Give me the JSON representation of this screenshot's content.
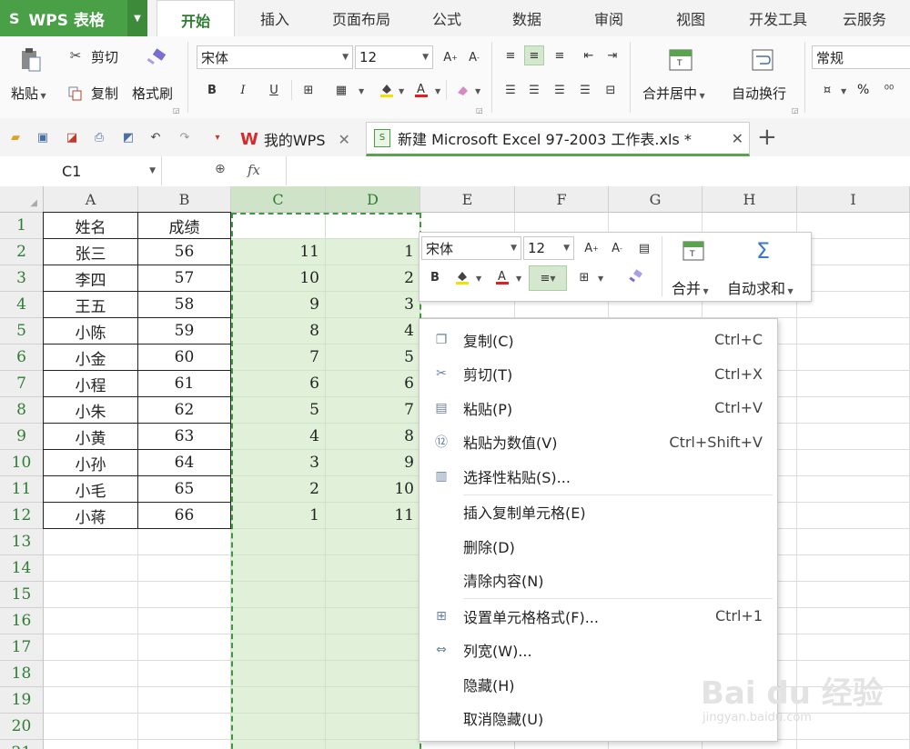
{
  "app": {
    "logo": "S",
    "title": "WPS 表格"
  },
  "menu_tabs": [
    "开始",
    "插入",
    "页面布局",
    "公式",
    "数据",
    "审阅",
    "视图",
    "开发工具",
    "云服务"
  ],
  "ribbon": {
    "paste": "粘贴",
    "cut": "剪切",
    "copy": "复制",
    "format_painter": "格式刷",
    "font_name": "宋体",
    "font_size": "12",
    "merge_center": "合并居中",
    "wrap_text": "自动换行",
    "number_format": "常规",
    "percent": "%"
  },
  "doc_tabs": {
    "home": "我的WPS",
    "file": "新建 Microsoft Excel 97-2003 工作表.xls *",
    "add": "+"
  },
  "formula_bar": {
    "name_box": "C1",
    "fx": "fx"
  },
  "columns": [
    "A",
    "B",
    "C",
    "D",
    "E",
    "F",
    "G",
    "H",
    "I"
  ],
  "rows": [
    "1",
    "2",
    "3",
    "4",
    "5",
    "6",
    "7",
    "8",
    "9",
    "10",
    "11",
    "12",
    "13",
    "14",
    "15",
    "16",
    "17",
    "18",
    "19",
    "20",
    "21"
  ],
  "sheet": {
    "A": [
      "姓名",
      "张三",
      "李四",
      "王五",
      "小陈",
      "小金",
      "小程",
      "小朱",
      "小黄",
      "小孙",
      "小毛",
      "小蒋"
    ],
    "B": [
      "成绩",
      "56",
      "57",
      "58",
      "59",
      "60",
      "61",
      "62",
      "63",
      "64",
      "65",
      "66"
    ],
    "C": [
      "",
      "11",
      "10",
      "9",
      "8",
      "7",
      "6",
      "5",
      "4",
      "3",
      "2",
      "1"
    ],
    "D": [
      "",
      "1",
      "2",
      "3",
      "4",
      "5",
      "6",
      "7",
      "8",
      "9",
      "10",
      "11"
    ]
  },
  "mini_toolbar": {
    "font_name": "宋体",
    "font_size": "12",
    "merge": "合并",
    "autosum": "自动求和"
  },
  "context_menu": [
    {
      "label": "复制(C)",
      "shortcut": "Ctrl+C",
      "icon": "copy-icon"
    },
    {
      "label": "剪切(T)",
      "shortcut": "Ctrl+X",
      "icon": "scissors-icon"
    },
    {
      "label": "粘贴(P)",
      "shortcut": "Ctrl+V",
      "icon": "paste-icon"
    },
    {
      "label": "粘贴为数值(V)",
      "shortcut": "Ctrl+Shift+V",
      "icon": "paste-values-icon"
    },
    {
      "label": "选择性粘贴(S)...",
      "shortcut": "",
      "icon": "paste-special-icon"
    },
    {
      "label": "插入复制单元格(E)",
      "shortcut": "",
      "icon": ""
    },
    {
      "label": "删除(D)",
      "shortcut": "",
      "icon": ""
    },
    {
      "label": "清除内容(N)",
      "shortcut": "",
      "icon": ""
    },
    {
      "label": "设置单元格格式(F)...",
      "shortcut": "Ctrl+1",
      "icon": "format-cells-icon"
    },
    {
      "label": "列宽(W)...",
      "shortcut": "",
      "icon": "column-width-icon"
    },
    {
      "label": "隐藏(H)",
      "shortcut": "",
      "icon": ""
    },
    {
      "label": "取消隐藏(U)",
      "shortcut": "",
      "icon": ""
    }
  ],
  "watermark": {
    "brand": "Bai du 经验",
    "url": "jingyan.baidu.com"
  },
  "colors": {
    "accent": "#4aa046",
    "selection": "#e1f1d9",
    "marquee": "#3d9a3d"
  }
}
